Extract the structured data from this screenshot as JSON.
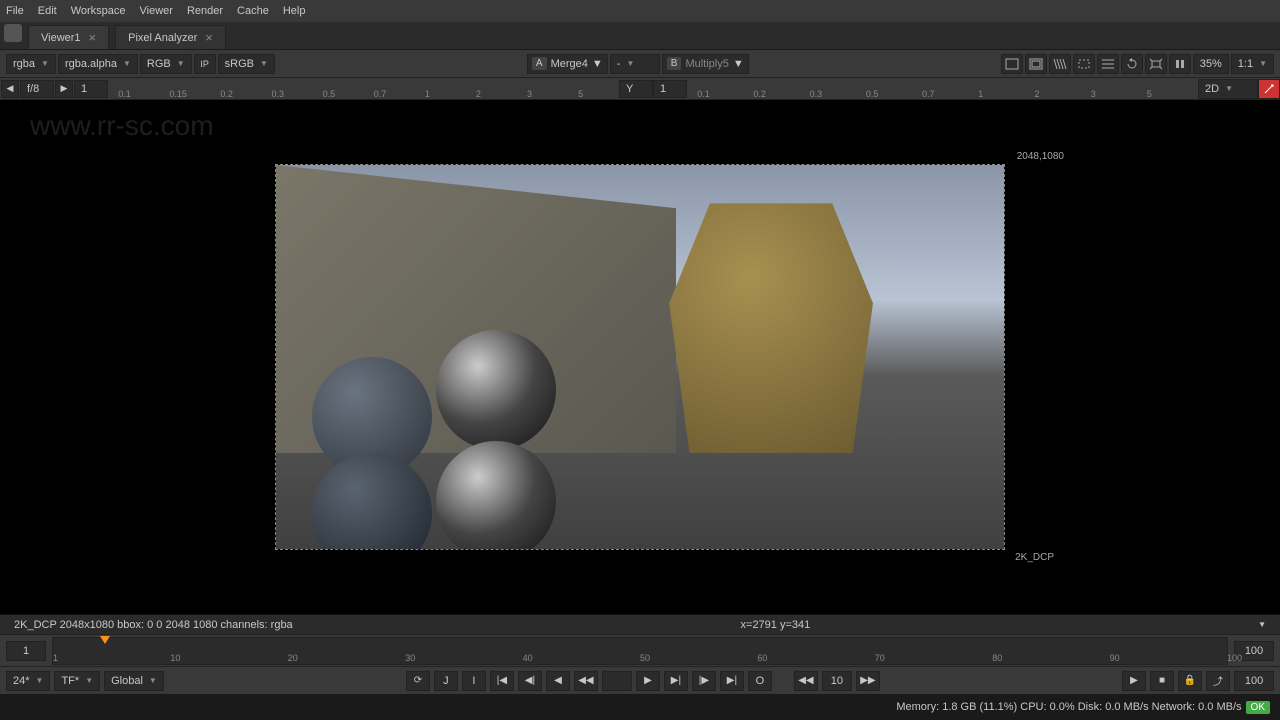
{
  "menu": {
    "items": [
      "File",
      "Edit",
      "Workspace",
      "Viewer",
      "Render",
      "Cache",
      "Help"
    ]
  },
  "tabs": [
    {
      "label": "Viewer1",
      "active": true
    },
    {
      "label": "Pixel Analyzer",
      "active": false
    }
  ],
  "toolbar": {
    "channel": "rgba",
    "alpha": "rgba.alpha",
    "colorspace": "RGB",
    "ip": "IP",
    "lut": "sRGB",
    "a_label": "A",
    "a_node": "Merge4",
    "b_label": "B",
    "b_node": "Multiply5",
    "dash": "-",
    "zoom_pct": "35%",
    "ratio": "1:1"
  },
  "ruler": {
    "prev": "◀",
    "next": "▶",
    "fstop": "f/8",
    "fval": "1",
    "y_label": "Y",
    "y_val": "1",
    "ticks_left": [
      "0.1",
      "0.15",
      "0.2",
      "0.3",
      "0.5",
      "0.7",
      "1",
      "2",
      "3",
      "5"
    ],
    "ticks_right": [
      "0.1",
      "0.2",
      "0.3",
      "0.5",
      "0.7",
      "1",
      "2",
      "3",
      "5"
    ],
    "view_mode": "2D"
  },
  "viewer": {
    "resolution": "2048,1080",
    "format": "2K_DCP"
  },
  "info": {
    "left": "2K_DCP 2048x1080  bbox: 0 0 2048 1080 channels: rgba",
    "coords": "x=2791 y=341"
  },
  "timeline": {
    "start": "1",
    "end": "100",
    "ticks": [
      "1",
      "10",
      "20",
      "30",
      "40",
      "50",
      "60",
      "70",
      "80",
      "90",
      "100"
    ]
  },
  "playback": {
    "fps": "24*",
    "tf": "TF*",
    "scope": "Global",
    "jump": "10",
    "end": "100",
    "j_icon": "J",
    "i_icon": "I",
    "o_icon": "O"
  },
  "status": {
    "text": "Memory: 1.8 GB (11.1%) CPU: 0.0% Disk: 0.0 MB/s Network: 0.0 MB/s",
    "ok": "OK"
  },
  "watermark": {
    "url": "www.rr-sc.com"
  }
}
